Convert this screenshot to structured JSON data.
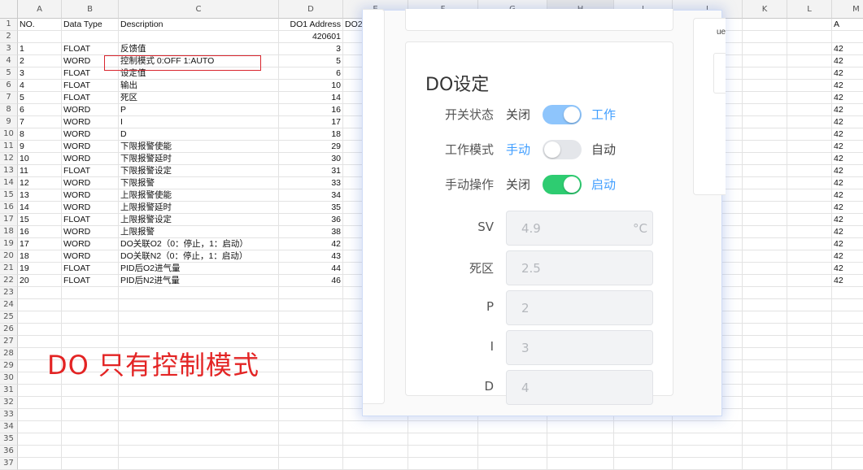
{
  "sheet": {
    "columns": [
      "A",
      "B",
      "C",
      "D",
      "E",
      "F",
      "G",
      "H",
      "I",
      "J",
      "K",
      "L",
      "M"
    ],
    "row_numbers": [
      "1",
      "2",
      "3",
      "4",
      "5",
      "6",
      "7",
      "8",
      "9",
      "10",
      "11",
      "12",
      "13",
      "14",
      "15",
      "16",
      "17",
      "18",
      "19",
      "20",
      "21",
      "22",
      "23",
      "24",
      "25",
      "26",
      "27",
      "28",
      "29",
      "30",
      "31",
      "32",
      "33",
      "34",
      "35",
      "36",
      "37"
    ],
    "rows": [
      {
        "a": "NO.",
        "b": "Data Type",
        "c": "Description",
        "d": "DO1 Address",
        "e": "DO2",
        "m": "A"
      },
      {
        "a": "",
        "b": "",
        "c": "",
        "d": "420601",
        "e": "",
        "m": ""
      },
      {
        "a": "1",
        "b": "FLOAT",
        "c": "反馈值",
        "d": "3",
        "e": "",
        "m": "42"
      },
      {
        "a": "2",
        "b": "WORD",
        "c": "控制模式 0:OFF 1:AUTO",
        "d": "5",
        "e": "",
        "m": "42"
      },
      {
        "a": "3",
        "b": "FLOAT",
        "c": "设定值",
        "d": "6",
        "e": "",
        "m": "42"
      },
      {
        "a": "4",
        "b": "FLOAT",
        "c": "输出",
        "d": "10",
        "e": "",
        "m": "42"
      },
      {
        "a": "5",
        "b": "FLOAT",
        "c": "死区",
        "d": "14",
        "e": "",
        "m": "42"
      },
      {
        "a": "6",
        "b": "WORD",
        "c": "P",
        "d": "16",
        "e": "",
        "m": "42"
      },
      {
        "a": "7",
        "b": "WORD",
        "c": "I",
        "d": "17",
        "e": "",
        "m": "42"
      },
      {
        "a": "8",
        "b": "WORD",
        "c": "D",
        "d": "18",
        "e": "",
        "m": "42"
      },
      {
        "a": "9",
        "b": "WORD",
        "c": "下限报警使能",
        "d": "29",
        "e": "",
        "m": "42"
      },
      {
        "a": "10",
        "b": "WORD",
        "c": "下限报警延时",
        "d": "30",
        "e": "",
        "m": "42"
      },
      {
        "a": "11",
        "b": "FLOAT",
        "c": "下限报警设定",
        "d": "31",
        "e": "",
        "m": "42"
      },
      {
        "a": "12",
        "b": "WORD",
        "c": "下限报警",
        "d": "33",
        "e": "",
        "m": "42"
      },
      {
        "a": "13",
        "b": "WORD",
        "c": "上限报警使能",
        "d": "34",
        "e": "",
        "m": "42"
      },
      {
        "a": "14",
        "b": "WORD",
        "c": "上限报警延时",
        "d": "35",
        "e": "",
        "m": "42"
      },
      {
        "a": "15",
        "b": "FLOAT",
        "c": "上限报警设定",
        "d": "36",
        "e": "",
        "m": "42"
      },
      {
        "a": "16",
        "b": "WORD",
        "c": "上限报警",
        "d": "38",
        "e": "",
        "m": "42"
      },
      {
        "a": "17",
        "b": "WORD",
        "c": "DO关联O2（0：停止，1：启动）",
        "d": "42",
        "e": "",
        "m": "42"
      },
      {
        "a": "18",
        "b": "WORD",
        "c": "DO关联N2（0：停止，1：启动）",
        "d": "43",
        "e": "",
        "m": "42"
      },
      {
        "a": "19",
        "b": "FLOAT",
        "c": "PID后O2进气量",
        "d": "44",
        "e": "",
        "m": "42"
      },
      {
        "a": "20",
        "b": "FLOAT",
        "c": "PID后N2进气量",
        "d": "46",
        "e": "",
        "m": "42"
      }
    ]
  },
  "annotation": "DO 只有控制模式",
  "panel": {
    "title": "DO设定",
    "right_card_text": "ue",
    "controls": [
      {
        "label": "开关状态",
        "off_text": "关闭",
        "on_text": "工作",
        "state": "on",
        "color": "#8ec5fc"
      },
      {
        "label": "工作模式",
        "off_text": "手动",
        "on_text": "自动",
        "state": "off",
        "color": "#e4e6ea"
      },
      {
        "label": "手动操作",
        "off_text": "关闭",
        "on_text": "启动",
        "state": "on",
        "color": "#2ecc71"
      }
    ],
    "fields": [
      {
        "label": "SV",
        "value": "4.9",
        "unit": "°C"
      },
      {
        "label": "死区",
        "value": "2.5",
        "unit": ""
      },
      {
        "label": "P",
        "value": "2",
        "unit": ""
      },
      {
        "label": "I",
        "value": "3",
        "unit": ""
      },
      {
        "label": "D",
        "value": "4",
        "unit": ""
      }
    ],
    "colors": {
      "active_text": "#409eff",
      "inactive_text": "#444444",
      "on_blue": "#8ec5fc",
      "on_green": "#2ecc71"
    }
  }
}
